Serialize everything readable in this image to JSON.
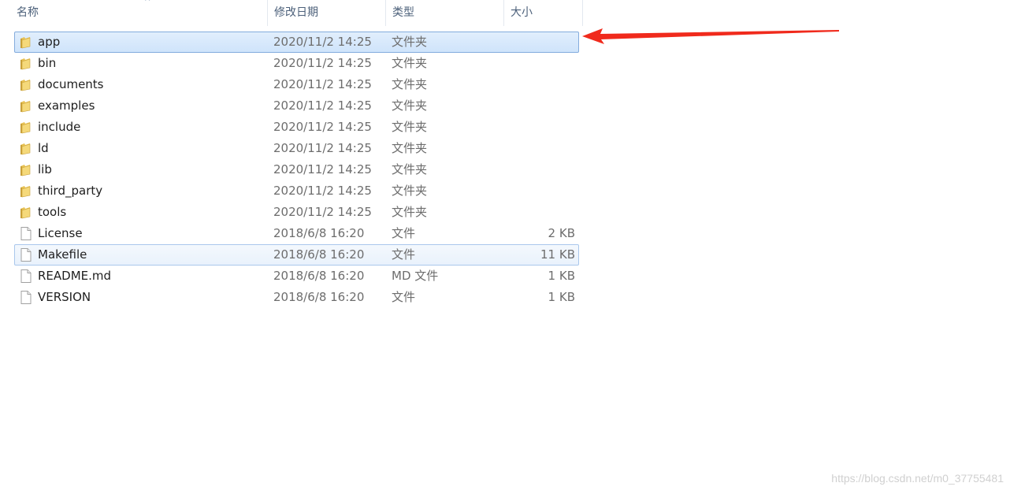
{
  "columns": {
    "name": "名称",
    "date": "修改日期",
    "type": "类型",
    "size": "大小",
    "sort_indicator": "^"
  },
  "files": [
    {
      "name": "app",
      "date": "2020/11/2 14:25",
      "type": "文件夹",
      "size": "",
      "icon": "folder-icon",
      "state": "selected"
    },
    {
      "name": "bin",
      "date": "2020/11/2 14:25",
      "type": "文件夹",
      "size": "",
      "icon": "folder-icon",
      "state": ""
    },
    {
      "name": "documents",
      "date": "2020/11/2 14:25",
      "type": "文件夹",
      "size": "",
      "icon": "folder-icon",
      "state": ""
    },
    {
      "name": "examples",
      "date": "2020/11/2 14:25",
      "type": "文件夹",
      "size": "",
      "icon": "folder-icon",
      "state": ""
    },
    {
      "name": "include",
      "date": "2020/11/2 14:25",
      "type": "文件夹",
      "size": "",
      "icon": "folder-icon",
      "state": ""
    },
    {
      "name": "ld",
      "date": "2020/11/2 14:25",
      "type": "文件夹",
      "size": "",
      "icon": "folder-icon",
      "state": ""
    },
    {
      "name": "lib",
      "date": "2020/11/2 14:25",
      "type": "文件夹",
      "size": "",
      "icon": "folder-icon",
      "state": ""
    },
    {
      "name": "third_party",
      "date": "2020/11/2 14:25",
      "type": "文件夹",
      "size": "",
      "icon": "folder-icon",
      "state": ""
    },
    {
      "name": "tools",
      "date": "2020/11/2 14:25",
      "type": "文件夹",
      "size": "",
      "icon": "folder-icon",
      "state": ""
    },
    {
      "name": "License",
      "date": "2018/6/8 16:20",
      "type": "文件",
      "size": "2 KB",
      "icon": "file-icon",
      "state": ""
    },
    {
      "name": "Makefile",
      "date": "2018/6/8 16:20",
      "type": "文件",
      "size": "11 KB",
      "icon": "file-icon",
      "state": "hover"
    },
    {
      "name": "README.md",
      "date": "2018/6/8 16:20",
      "type": "MD 文件",
      "size": "1 KB",
      "icon": "file-icon",
      "state": ""
    },
    {
      "name": "VERSION",
      "date": "2018/6/8 16:20",
      "type": "文件",
      "size": "1 KB",
      "icon": "file-icon",
      "state": ""
    }
  ],
  "annotation": {
    "arrow_icon": "red-arrow-icon",
    "color": "#f02a1c"
  },
  "watermark": "https://blog.csdn.net/m0_37755481",
  "colors": {
    "selected_bg": "#cfe4fb",
    "selected_border": "#84acdd",
    "folder": "#e8c253"
  }
}
